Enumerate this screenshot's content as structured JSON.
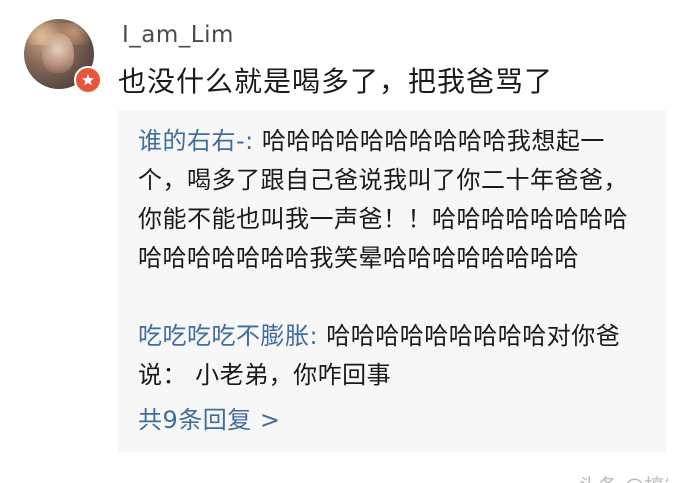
{
  "comment": {
    "username": "I_am_Lim",
    "text": "也没什么就是喝多了，把我爸骂了",
    "avatar_icon": "avatar-photo",
    "badge_icon": "verified-star-badge",
    "badge_color": "#e8553d"
  },
  "replies": [
    {
      "author": "谁的右右-:",
      "text": " 哈哈哈哈哈哈哈哈哈哈我想起一个，喝多了跟自己爸说我叫了你二十年爸爸，你能不能也叫我一声爸！！哈哈哈哈哈哈哈哈哈哈哈哈哈哈哈我笑晕哈哈哈哈哈哈哈哈"
    },
    {
      "author": "吃吃吃吃不膨胀:",
      "text": " 哈哈哈哈哈哈哈哈哈对你爸说： 小老弟，你咋回事"
    }
  ],
  "more_replies": "共9条回复 >",
  "watermark": "头条 @搞笑",
  "colors": {
    "link_blue": "#3f6d9e",
    "reply_bg": "#f7f7f7",
    "text": "#1a1a1a"
  }
}
